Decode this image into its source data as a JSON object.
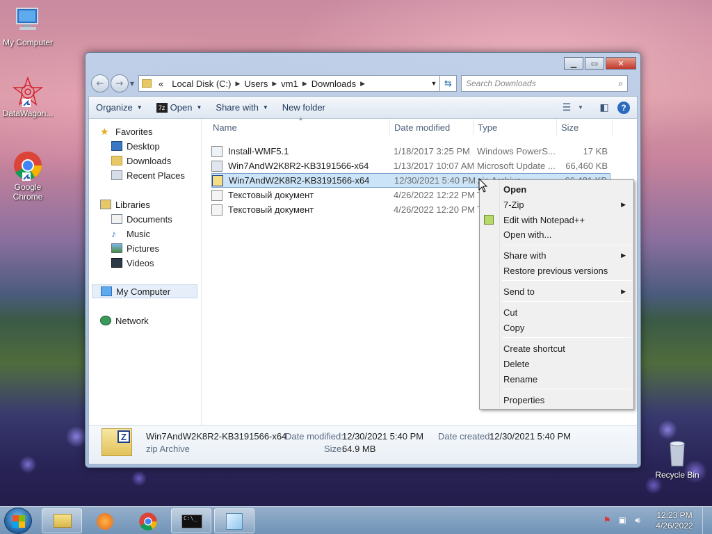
{
  "desktop": {
    "icons": [
      {
        "label": "My Computer"
      },
      {
        "label": "DataWagon..."
      },
      {
        "label": "Google Chrome"
      },
      {
        "label": "Recycle Bin"
      }
    ]
  },
  "window": {
    "address": {
      "overflow": "«",
      "segments": [
        "Local Disk (C:)",
        "Users",
        "vm1",
        "Downloads"
      ]
    },
    "search_placeholder": "Search Downloads",
    "toolbar": {
      "organize": "Organize",
      "open": "Open",
      "share_with": "Share with",
      "new_folder": "New folder"
    },
    "nav": {
      "favorites": "Favorites",
      "desktop": "Desktop",
      "downloads": "Downloads",
      "recent_places": "Recent Places",
      "libraries": "Libraries",
      "documents": "Documents",
      "music": "Music",
      "pictures": "Pictures",
      "videos": "Videos",
      "my_computer": "My Computer",
      "network": "Network"
    },
    "columns": {
      "name": "Name",
      "date_modified": "Date modified",
      "type": "Type",
      "size": "Size"
    },
    "files": [
      {
        "name": "Install-WMF5.1",
        "date": "1/18/2017 3:25 PM",
        "type": "Windows PowerS...",
        "size": "17 KB"
      },
      {
        "name": "Win7AndW2K8R2-KB3191566-x64",
        "date": "1/13/2017 10:07 AM",
        "type": "Microsoft Update ...",
        "size": "66,460 KB"
      },
      {
        "name": "Win7AndW2K8R2-KB3191566-x64",
        "date": "12/30/2021 5:40 PM",
        "type": "zip Archive",
        "size": "66,481 KB"
      },
      {
        "name": "Текстовый документ",
        "date": "4/26/2022 12:22 PM",
        "type": "T",
        "size": ""
      },
      {
        "name": "Текстовый документ",
        "date": "4/26/2022 12:20 PM",
        "type": "T",
        "size": ""
      }
    ],
    "details": {
      "name": "Win7AndW2K8R2-KB3191566-x64",
      "type": "zip Archive",
      "modified_label": "Date modified:",
      "modified_value": "12/30/2021 5:40 PM",
      "created_label": "Date created:",
      "created_value": "12/30/2021 5:40 PM",
      "size_label": "Size:",
      "size_value": "64.9 MB"
    }
  },
  "context_menu": {
    "open": "Open",
    "seven_zip": "7-Zip",
    "edit_notepad": "Edit with Notepad++",
    "open_with": "Open with...",
    "share_with": "Share with",
    "restore": "Restore previous versions",
    "send_to": "Send to",
    "cut": "Cut",
    "copy": "Copy",
    "create_shortcut": "Create shortcut",
    "delete": "Delete",
    "rename": "Rename",
    "properties": "Properties"
  },
  "taskbar": {
    "time": "12:23 PM",
    "date": "4/26/2022"
  }
}
